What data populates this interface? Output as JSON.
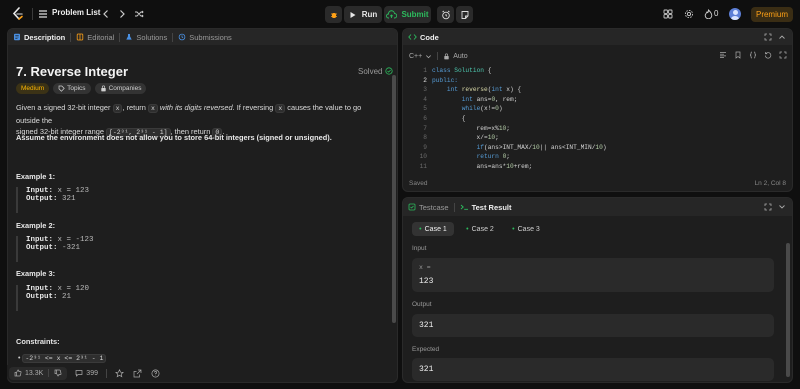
{
  "topbar": {
    "problem_list": "Problem List",
    "run": "Run",
    "submit": "Submit",
    "streak_count": "0",
    "premium": "Premium"
  },
  "description": {
    "tabs": [
      "Description",
      "Editorial",
      "Solutions",
      "Submissions"
    ],
    "title": "7. Reverse Integer",
    "solved": "Solved",
    "tags": [
      "Medium",
      "Topics",
      "Companies"
    ],
    "p1_a": "Given a signed 32-bit integer ",
    "p1_x": "x",
    "p1_b": ", return ",
    "p1_c": " with its digits reversed",
    "p1_d": ". If reversing ",
    "p1_e": " causes the value to go outside the",
    "p1_f": "signed 32-bit integer range ",
    "p1_range": "[-2³¹, 2³¹ - 1]",
    "p1_g": ", then return ",
    "p1_zero": "0",
    "p1_h": ".",
    "assume": "Assume the environment does not allow you to store 64-bit integers (signed or unsigned).",
    "examples": [
      {
        "label": "Example 1:",
        "input_label": "Input:",
        "input": "x = 123",
        "output_label": "Output:",
        "output": "321"
      },
      {
        "label": "Example 2:",
        "input_label": "Input:",
        "input": "x = -123",
        "output_label": "Output:",
        "output": "-321"
      },
      {
        "label": "Example 3:",
        "input_label": "Input:",
        "input": "x = 120",
        "output_label": "Output:",
        "output": "21"
      }
    ],
    "constraints": "Constraints:",
    "constraint1": "-2³¹ <= x <= 2³¹ - 1",
    "likes": "13.3K",
    "comments": "399"
  },
  "code": {
    "tab": "Code",
    "language": "C++",
    "auto": "Auto",
    "lines": [
      "class Solution {",
      "public:",
      "    int reverse(int x) {",
      "        int ans=0, rem;",
      "        while(x!=0)",
      "        {",
      "            rem=x%10;",
      "            x/=10;",
      "            if(ans>INT_MAX/10|| ans<INT_MIN/10)",
      "            return 0;",
      "            ans=ans*10+rem;"
    ],
    "line_numbers": [
      "1",
      "2",
      "3",
      "4",
      "5",
      "6",
      "7",
      "8",
      "9",
      "10",
      "11"
    ],
    "saved": "Saved",
    "cursor": "Ln 2, Col 8"
  },
  "result": {
    "tabs": [
      "Testcase",
      "Test Result"
    ],
    "cases": [
      "Case 1",
      "Case 2",
      "Case 3"
    ],
    "input_label": "Input",
    "input_var": "x =",
    "input_value": "123",
    "output_label": "Output",
    "output_value": "321",
    "expected_label": "Expected",
    "expected_value": "321"
  },
  "colors": {
    "accent_orange": "#ffa116",
    "green": "#2cbb5d",
    "medium": "#ffb800"
  }
}
